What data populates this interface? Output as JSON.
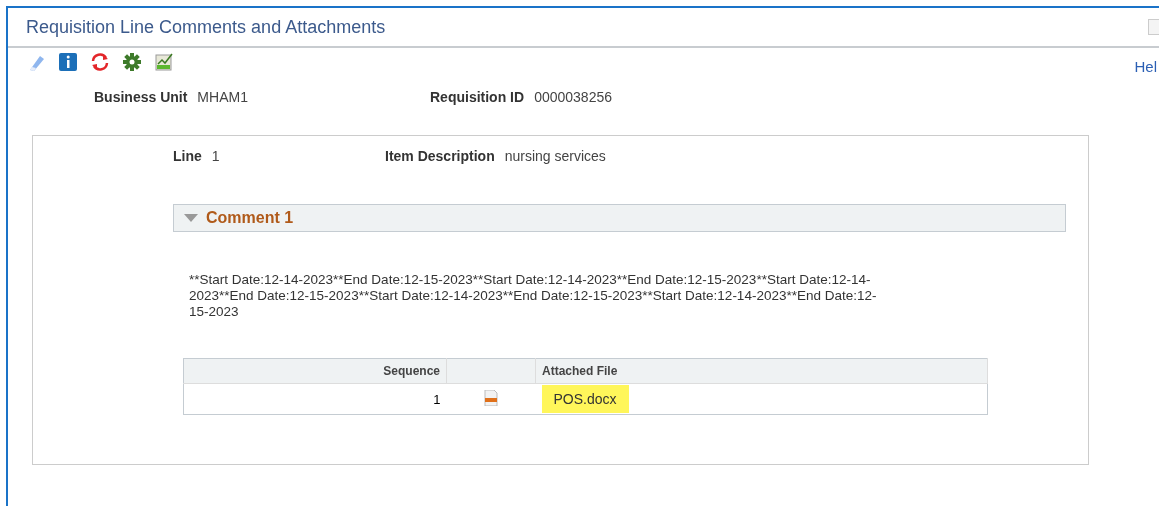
{
  "window": {
    "title": "Requisition Line Comments and Attachments"
  },
  "help_link": "Hel",
  "header_fields": [
    {
      "label": "Business Unit",
      "value": "MHAM1"
    },
    {
      "label": "Requisition ID",
      "value": "0000038256"
    }
  ],
  "line_fields": [
    {
      "label": "Line",
      "value": "1"
    },
    {
      "label": "Item Description",
      "value": "nursing services"
    }
  ],
  "comment": {
    "title": "Comment 1",
    "expanded": true,
    "text": "**Start Date:12-14-2023**End Date:12-15-2023**Start Date:12-14-2023**End Date:12-15-2023**Start Date:12-14-2023**End Date:12-15-2023**Start Date:12-14-2023**End Date:12-15-2023**Start Date:12-14-2023**End Date:12-15-2023"
  },
  "attachments": {
    "columns": [
      "Sequence",
      "Attached File"
    ],
    "rows": [
      {
        "sequence": "1",
        "file": "POS.docx",
        "highlighted": true
      }
    ]
  }
}
